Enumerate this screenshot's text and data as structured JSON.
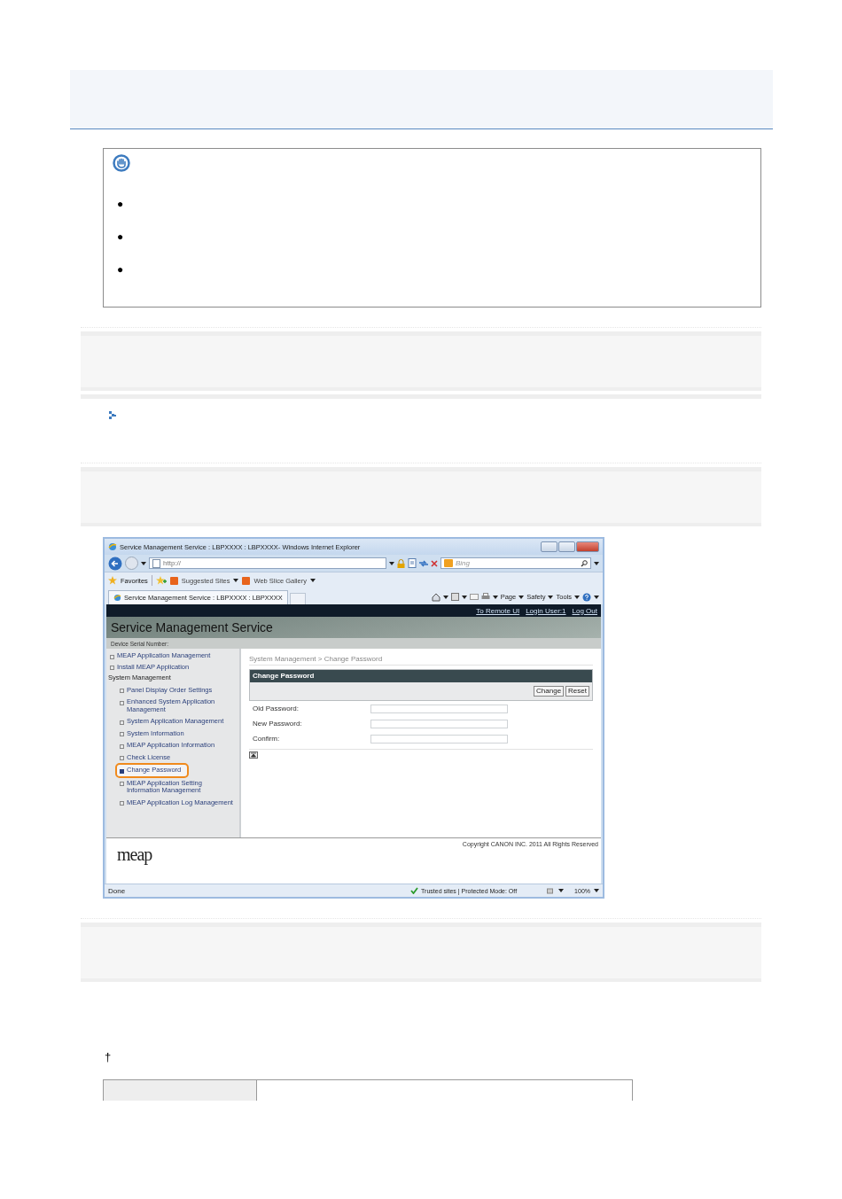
{
  "note": {
    "bullet_marks": [
      "●",
      "●",
      "●"
    ]
  },
  "browser": {
    "title": "Service Management Service : LBPXXXX : LBPXXXX- Windows Internet Explorer",
    "address": "http://",
    "search_placeholder": "Bing",
    "favorites_bar": [
      {
        "label": "Favorites",
        "kind": "favorites"
      },
      {
        "label": "Suggested Sites",
        "kind": "dropdown"
      },
      {
        "label": "Web Slice Gallery",
        "kind": "dropdown"
      }
    ],
    "tab": {
      "label": "Service Management Service : LBPXXXX : LBPXXXX"
    },
    "commands": [
      "Page",
      "Safety",
      "Tools"
    ],
    "status": {
      "text": "Done",
      "zone": "Trusted sites | Protected Mode: Off",
      "zoom": "100%"
    }
  },
  "app": {
    "top_links": [
      "To Remote UI",
      "Login User:1",
      "Log Out"
    ],
    "title": "Service Management Service",
    "serial_label": "Device Serial Number:",
    "sidebar": [
      {
        "label": "MEAP Application Management",
        "kind": "link",
        "selected": false
      },
      {
        "label": "Install MEAP Application",
        "kind": "link",
        "selected": false
      },
      {
        "label": "System Management",
        "kind": "heading",
        "selected": false,
        "children": [
          {
            "label": "Panel Display Order Settings",
            "selected": false
          },
          {
            "label": "Enhanced System Application Management",
            "selected": false
          },
          {
            "label": "System Application Management",
            "selected": false
          },
          {
            "label": "System Information",
            "selected": false
          },
          {
            "label": "MEAP Application Information",
            "selected": false
          },
          {
            "label": "Check License",
            "selected": false
          },
          {
            "label": "Change Password",
            "selected": true
          },
          {
            "label": "MEAP Application Setting Information Management",
            "selected": false
          },
          {
            "label": "MEAP Application Log Management",
            "selected": false
          }
        ]
      }
    ],
    "breadcrumb": "System Management > Change Password",
    "panel_title": "Change Password",
    "buttons": [
      "Change",
      "Reset"
    ],
    "fields": [
      {
        "label": "Old Password:"
      },
      {
        "label": "New Password:"
      },
      {
        "label": "Confirm:"
      }
    ],
    "copyright": "Copyright CANON INC. 2011 All Rights Reserved",
    "logo": "meap"
  },
  "footnote_mark": "†"
}
